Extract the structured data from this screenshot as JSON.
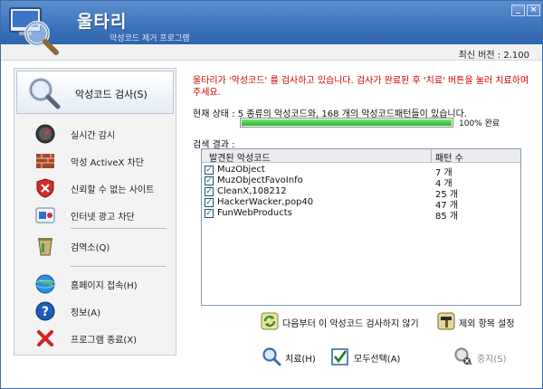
{
  "header": {
    "title": "울타리",
    "subtitle": "악성코드 제거 프로그램",
    "window_buttons": [
      "_",
      "×"
    ]
  },
  "version": {
    "text": "최신 버전 : 2.100"
  },
  "sidebar": {
    "main": {
      "label": "악성코드 검사(S)",
      "icon": "magnifier-icon"
    },
    "items": [
      {
        "label": "실시간 감시",
        "icon": "gauge-icon"
      },
      {
        "label": "악성 ActiveX 차단",
        "icon": "brick-wall-icon"
      },
      {
        "label": "신뢰할 수 없는 사이트",
        "icon": "shield-x-icon"
      },
      {
        "label": "인터넷 광고 차단",
        "icon": "ad-block-icon"
      },
      {
        "label": "검역소(Q)",
        "icon": "quarantine-bin-icon"
      },
      {
        "label": "홈페이지 접속(H)",
        "icon": "globe-icon"
      },
      {
        "label": "정보(A)",
        "icon": "help-icon"
      },
      {
        "label": "프로그램 종료(X)",
        "icon": "red-x-icon"
      }
    ]
  },
  "scan": {
    "status_message": "울타리가 '악성코드' 를 검사하고 있습니다. 검사가 완료된 후 '치료' 버튼을 눌러 치료하여 주세요.",
    "current_status": "현재 상태 :  5 종류의 악성코드와, 168 개의 악성코드패턴들이 있습니다.",
    "progress_percent": 100,
    "progress_label": "100% 완료",
    "results_label": "검색 결과 :"
  },
  "table": {
    "headers": [
      "발견된 악성코드",
      "패턴 수"
    ],
    "rows": [
      {
        "name": "MuzObject",
        "count": "7 개",
        "checked": true
      },
      {
        "name": "MuzObjectFavoInfo",
        "count": "4 개",
        "checked": true
      },
      {
        "name": "CleanX,108212",
        "count": "25 개",
        "checked": true
      },
      {
        "name": "HackerWacker,pop40",
        "count": "47 개",
        "checked": true
      },
      {
        "name": "FunWebProducts",
        "count": "85 개",
        "checked": true
      }
    ]
  },
  "options": {
    "skip_label": "다음부터 이 악성코드 검사하지 않기",
    "exclude_label": "제외 항목 설정"
  },
  "actions": {
    "treat_label": "치료(H)",
    "select_all_label": "모두선택(A)",
    "stop_label": "중지(S)"
  },
  "colors": {
    "header_blue": "#3f75bd",
    "alert_red": "#d00000",
    "progress_green": "#23b623"
  }
}
